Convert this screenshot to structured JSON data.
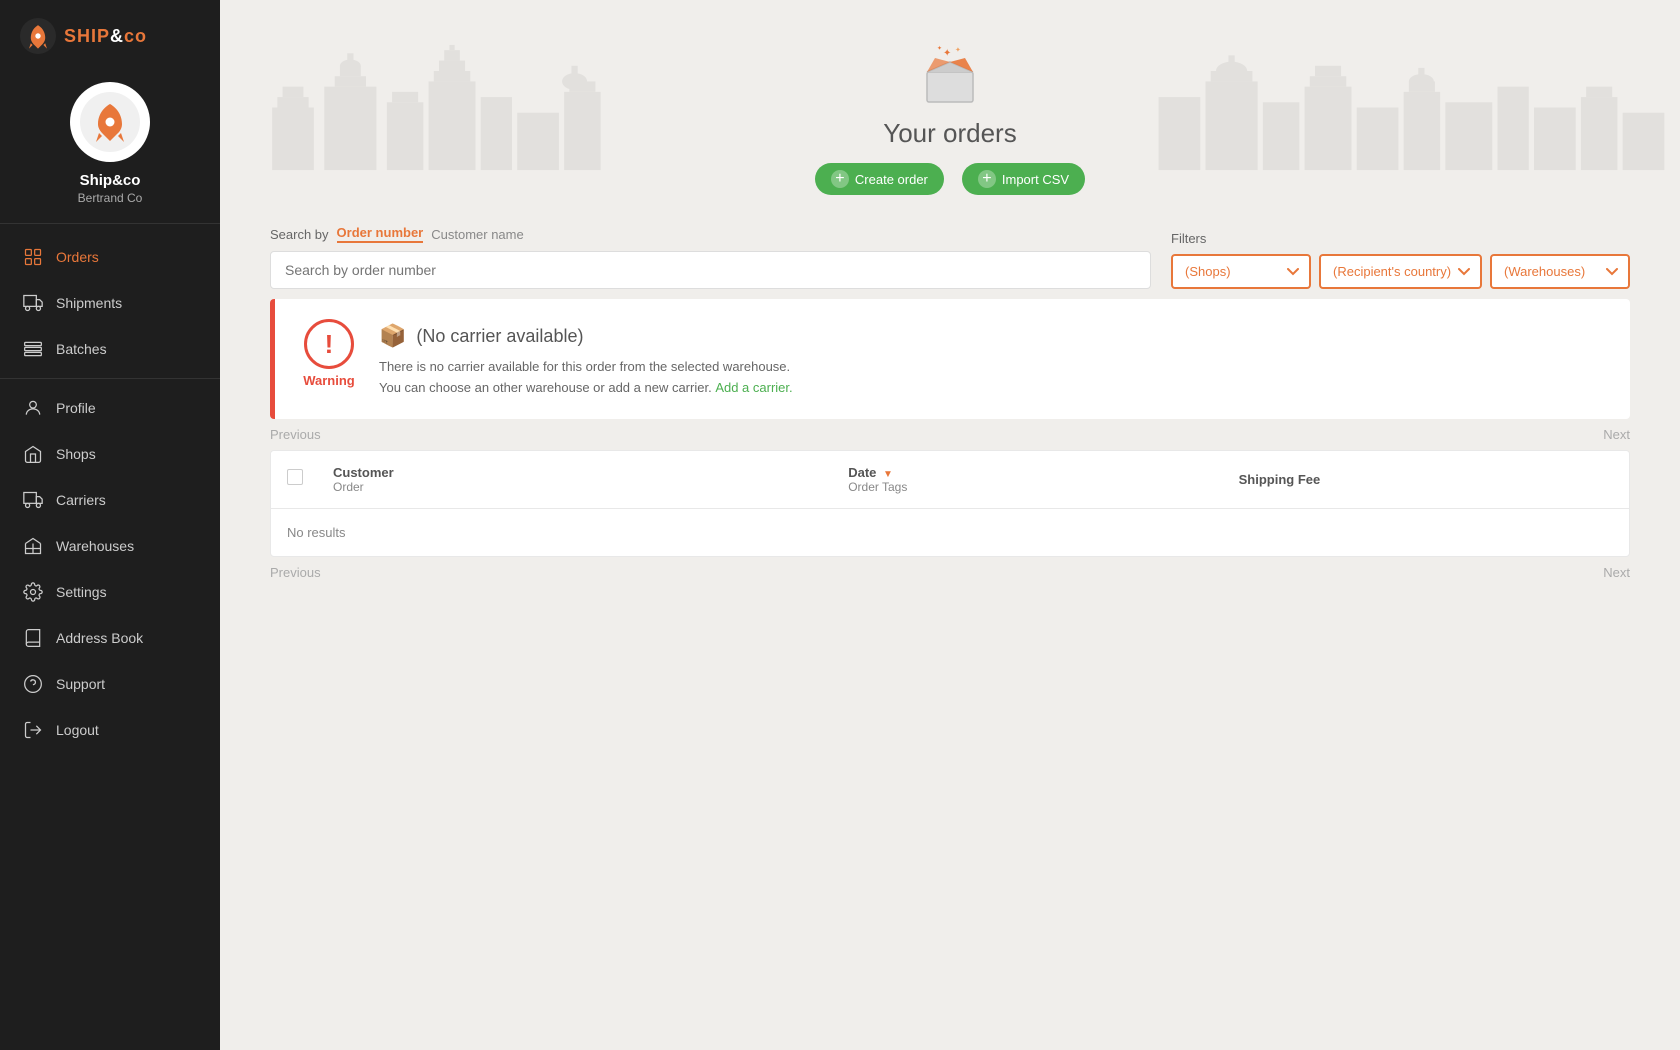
{
  "app": {
    "name": "SHIP",
    "name_suffix": "&co"
  },
  "user": {
    "name": "Ship&co",
    "company": "Bertrand Co"
  },
  "sidebar": {
    "items": [
      {
        "id": "orders",
        "label": "Orders",
        "active": true
      },
      {
        "id": "shipments",
        "label": "Shipments",
        "active": false
      },
      {
        "id": "batches",
        "label": "Batches",
        "active": false
      },
      {
        "id": "profile",
        "label": "Profile",
        "active": false
      },
      {
        "id": "shops",
        "label": "Shops",
        "active": false
      },
      {
        "id": "carriers",
        "label": "Carriers",
        "active": false
      },
      {
        "id": "warehouses",
        "label": "Warehouses",
        "active": false
      },
      {
        "id": "settings",
        "label": "Settings",
        "active": false
      },
      {
        "id": "address-book",
        "label": "Address Book",
        "active": false
      },
      {
        "id": "support",
        "label": "Support",
        "active": false
      },
      {
        "id": "logout",
        "label": "Logout",
        "active": false
      }
    ]
  },
  "hero": {
    "title": "Your orders",
    "create_order_label": "Create order",
    "import_csv_label": "Import CSV"
  },
  "search": {
    "by_label": "Search by",
    "active_tab": "Order number",
    "inactive_tab": "Customer name",
    "placeholder": "Search by order number"
  },
  "filters": {
    "label": "Filters",
    "shops_placeholder": "(Shops)",
    "country_placeholder": "(Recipient's country)",
    "warehouses_placeholder": "(Warehouses)"
  },
  "warning": {
    "label": "Warning",
    "title": "(No carrier available)",
    "line1": "There is no carrier available for this order from the selected warehouse.",
    "line2": "You can choose an other warehouse or add a new carrier.",
    "link_text": "Add a carrier."
  },
  "pagination": {
    "previous": "Previous",
    "next": "Next"
  },
  "table": {
    "col_customer": "Customer",
    "col_order": "Order",
    "col_date": "Date",
    "col_date_sort": "▼",
    "col_tags": "Order Tags",
    "col_shipping": "Shipping Fee",
    "no_results": "No results"
  }
}
